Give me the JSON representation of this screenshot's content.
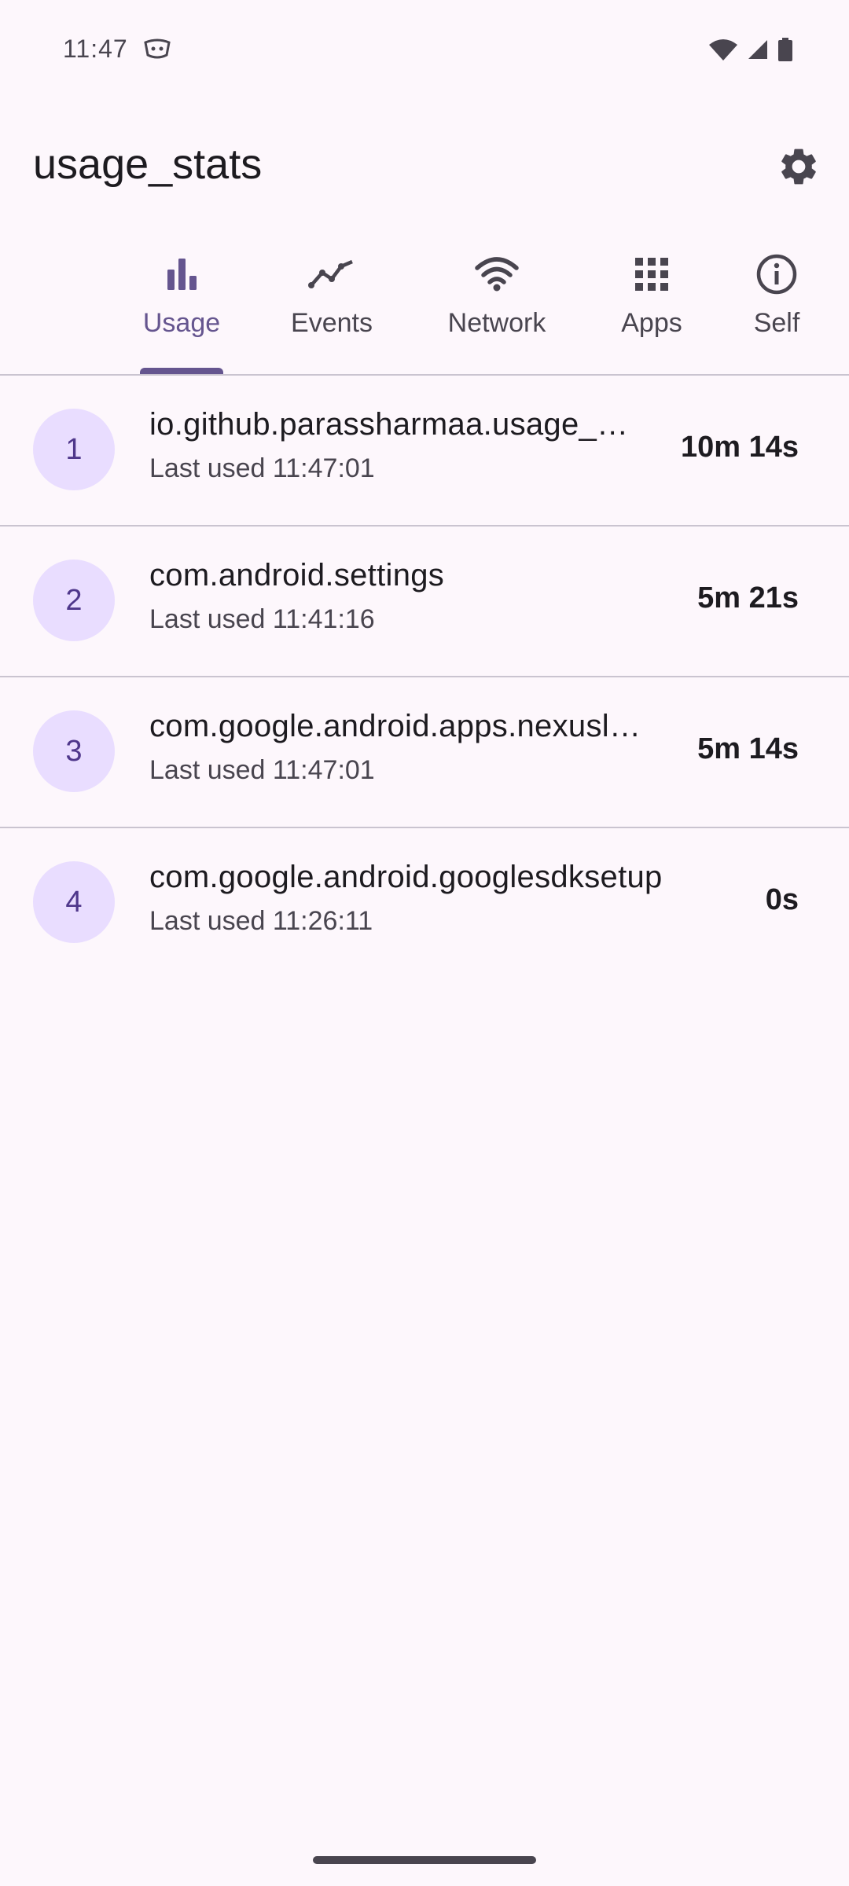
{
  "status_bar": {
    "time": "11:47",
    "app_icon": "android-debug-icon",
    "icons": [
      "wifi-icon",
      "cellular-signal-icon",
      "battery-icon"
    ]
  },
  "app_bar": {
    "title": "usage_stats",
    "action_icon": "gear-icon"
  },
  "tabs": [
    {
      "label": "Usage",
      "icon": "bar-chart-icon",
      "selected": true
    },
    {
      "label": "Events",
      "icon": "line-chart-icon",
      "selected": false
    },
    {
      "label": "Network",
      "icon": "wifi-icon",
      "selected": false
    },
    {
      "label": "Apps",
      "icon": "apps-grid-icon",
      "selected": false
    },
    {
      "label": "Self",
      "icon": "info-icon",
      "selected": false
    }
  ],
  "usage_list": [
    {
      "rank": "1",
      "package": "io.github.parassharmaa.usage_stats_example",
      "last_used": "Last used 11:47:01",
      "duration": "10m 14s"
    },
    {
      "rank": "2",
      "package": "com.android.settings",
      "last_used": "Last used 11:41:16",
      "duration": "5m 21s"
    },
    {
      "rank": "3",
      "package": "com.google.android.apps.nexuslauncher",
      "last_used": "Last used 11:47:01",
      "duration": "5m 14s"
    },
    {
      "rank": "4",
      "package": "com.google.android.googlesdksetup",
      "last_used": "Last used 11:26:11",
      "duration": "0s"
    }
  ],
  "colors": {
    "background": "#fdf7fc",
    "accent": "#65558f",
    "rank_circle": "#e9ddff",
    "divider": "#cac4d0",
    "text_primary": "#1d1b20",
    "text_secondary": "#49454f"
  }
}
